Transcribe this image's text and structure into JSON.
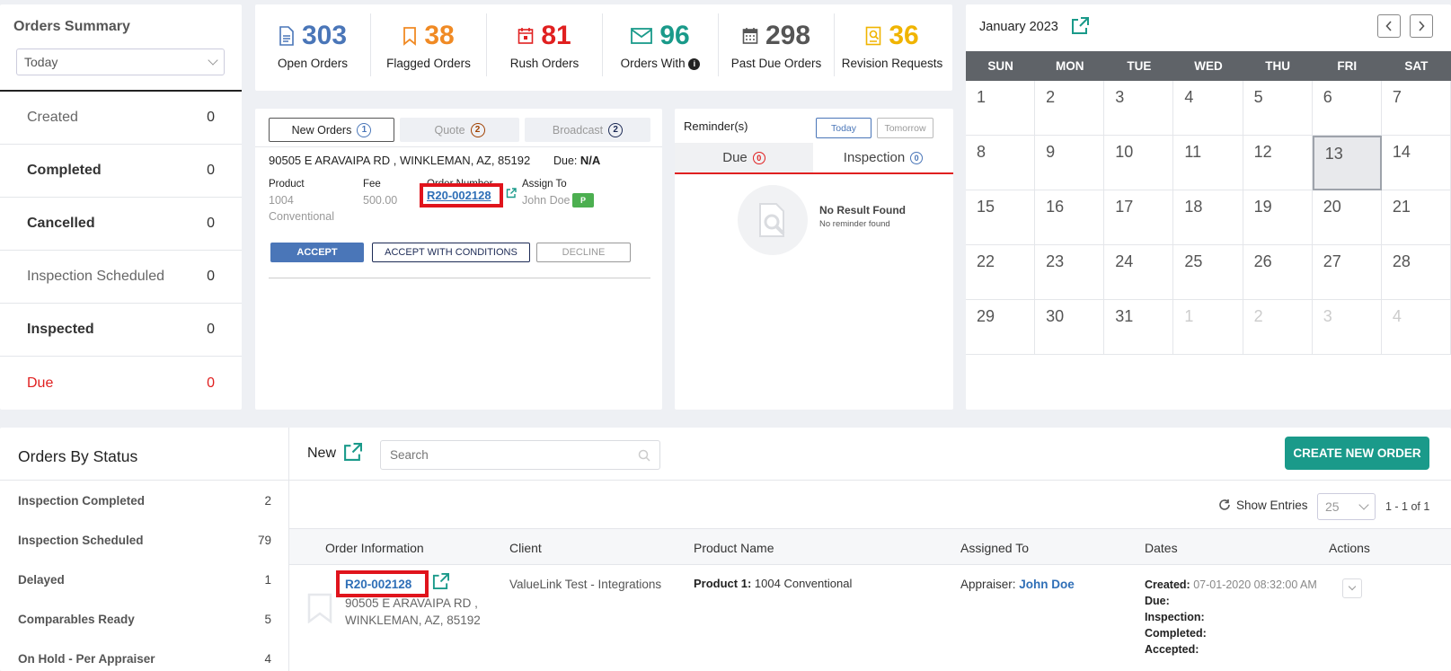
{
  "summary": {
    "title": "Orders Summary",
    "period": "Today",
    "rows": [
      {
        "label": "Created",
        "count": "0"
      },
      {
        "label": "Completed",
        "count": "0"
      },
      {
        "label": "Cancelled",
        "count": "0"
      },
      {
        "label": "Inspection Scheduled",
        "count": "0"
      },
      {
        "label": "Inspected",
        "count": "0"
      },
      {
        "label": "Due",
        "count": "0"
      }
    ]
  },
  "stats": [
    {
      "value": "303",
      "label": "Open Orders",
      "icon": "document-icon",
      "color": "#4a76b8"
    },
    {
      "value": "38",
      "label": "Flagged Orders",
      "icon": "bookmark-icon",
      "color": "#f08a24"
    },
    {
      "value": "81",
      "label": "Rush Orders",
      "icon": "calendar-alert-icon",
      "color": "#e02020"
    },
    {
      "value": "96",
      "label": "Orders With",
      "icon": "envelope-icon",
      "color": "#1a9a8a"
    },
    {
      "value": "298",
      "label": "Past Due Orders",
      "icon": "calendar-icon",
      "color": "#555555"
    },
    {
      "value": "36",
      "label": "Revision Requests",
      "icon": "revision-icon",
      "color": "#f0b400"
    }
  ],
  "new_orders": {
    "tabs": [
      {
        "label": "New Orders",
        "count": "1"
      },
      {
        "label": "Quote",
        "count": "2"
      },
      {
        "label": "Broadcast",
        "count": "2"
      }
    ],
    "address": "90505 E ARAVAIPA RD , WINKLEMAN, AZ, 85192",
    "due_label": "Due:",
    "due_value": "N/A",
    "product_label": "Product",
    "product_value_1": "1004",
    "product_value_2": "Conventional",
    "fee_label": "Fee",
    "fee_value": "500.00",
    "order_number_label": "Order Number",
    "order_number": "R20-002128",
    "assign_label": "Assign To",
    "assignee": "John Doe",
    "assignee_badge": "P",
    "accept": "ACCEPT",
    "accept_conditions": "ACCEPT WITH CONDITIONS",
    "decline": "DECLINE"
  },
  "reminders": {
    "title": "Reminder(s)",
    "today": "Today",
    "tomorrow": "Tomorrow",
    "tab_due": "Due",
    "tab_due_count": "0",
    "tab_inspection": "Inspection",
    "tab_inspection_count": "0",
    "empty_title": "No Result Found",
    "empty_sub": "No reminder found"
  },
  "calendar": {
    "month": "January 2023",
    "weekdays": [
      "SUN",
      "MON",
      "TUE",
      "WED",
      "THU",
      "FRI",
      "SAT"
    ],
    "days": [
      "1",
      "2",
      "3",
      "4",
      "5",
      "6",
      "7",
      "8",
      "9",
      "10",
      "11",
      "12",
      "13",
      "14",
      "15",
      "16",
      "17",
      "18",
      "19",
      "20",
      "21",
      "22",
      "23",
      "24",
      "25",
      "26",
      "27",
      "28",
      "29",
      "30",
      "31",
      "1",
      "2",
      "3",
      "4"
    ],
    "today": "13"
  },
  "orders_by_status": {
    "title": "Orders By Status",
    "rows": [
      {
        "label": "Inspection Completed",
        "count": "2"
      },
      {
        "label": "Inspection Scheduled",
        "count": "79"
      },
      {
        "label": "Delayed",
        "count": "1"
      },
      {
        "label": "Comparables Ready",
        "count": "5"
      },
      {
        "label": "On Hold - Per Appraiser",
        "count": "4"
      }
    ]
  },
  "orders_table": {
    "heading": "New",
    "search_placeholder": "Search",
    "create_button": "CREATE NEW ORDER",
    "show_entries": "Show Entries",
    "entries_value": "25",
    "range": "1 - 1 of 1",
    "columns": [
      "Order Information",
      "Client",
      "Product Name",
      "Assigned To",
      "Dates",
      "Actions"
    ],
    "row": {
      "order_number": "R20-002128",
      "address_1": "90505 E ARAVAIPA RD ,",
      "address_2": "WINKLEMAN, AZ, 85192",
      "client": "ValueLink Test - Integrations",
      "product_label": "Product 1:",
      "product_value": "1004 Conventional",
      "appraiser_label": "Appraiser:",
      "appraiser": "John Doe",
      "created_label": "Created:",
      "created_value": "07-01-2020 08:32:00 AM",
      "due_label": "Due:",
      "inspection_label": "Inspection:",
      "completed_label": "Completed:",
      "accepted_label": "Accepted:"
    }
  }
}
